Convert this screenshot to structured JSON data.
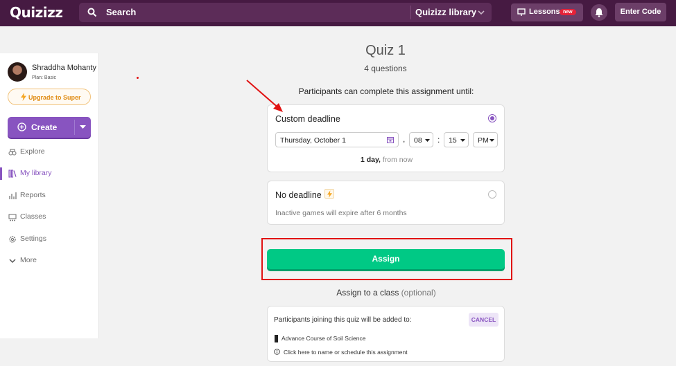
{
  "header": {
    "logo": "Quizizz",
    "search_label": "Search",
    "library_label": "Quizizz library",
    "lessons_label": "Lessons",
    "lessons_badge": "new",
    "enter_code": "Enter Code"
  },
  "sidebar": {
    "user_name": "Shraddha Mohanty",
    "plan": "Plan: Basic",
    "upgrade_label": "Upgrade to Super",
    "create_label": "Create",
    "items": [
      {
        "label": "Explore",
        "icon": "explore-icon"
      },
      {
        "label": "My library",
        "icon": "library-icon",
        "active": true
      },
      {
        "label": "Reports",
        "icon": "reports-icon"
      },
      {
        "label": "Classes",
        "icon": "classes-icon"
      },
      {
        "label": "Settings",
        "icon": "settings-icon"
      },
      {
        "label": "More",
        "icon": "chevron-down-icon"
      }
    ]
  },
  "quiz": {
    "title": "Quiz 1",
    "questions": "4 questions",
    "until_label": "Participants can complete this assignment until:"
  },
  "custom_deadline": {
    "title": "Custom deadline",
    "date": "Thursday, October 1",
    "hour": "08",
    "minute": "15",
    "ampm": "PM",
    "duration": "1 day,",
    "duration_suffix": " from now"
  },
  "no_deadline": {
    "title": "No deadline",
    "note": "Inactive games will expire after 6 months"
  },
  "assign": {
    "button_label": "Assign",
    "class_label": "Assign to a class",
    "class_optional": "(optional)"
  },
  "class_card": {
    "join_text": "Participants joining this quiz will be added to:",
    "cancel_label": "CANCEL",
    "course": "Advance Course of Soil Science",
    "click_here": "Click here to name or schedule this assignment"
  },
  "colors": {
    "header_bg": "#461a42",
    "accent_purple": "#8854c0",
    "assign_green": "#00c985",
    "annotation_red": "#e11313"
  }
}
